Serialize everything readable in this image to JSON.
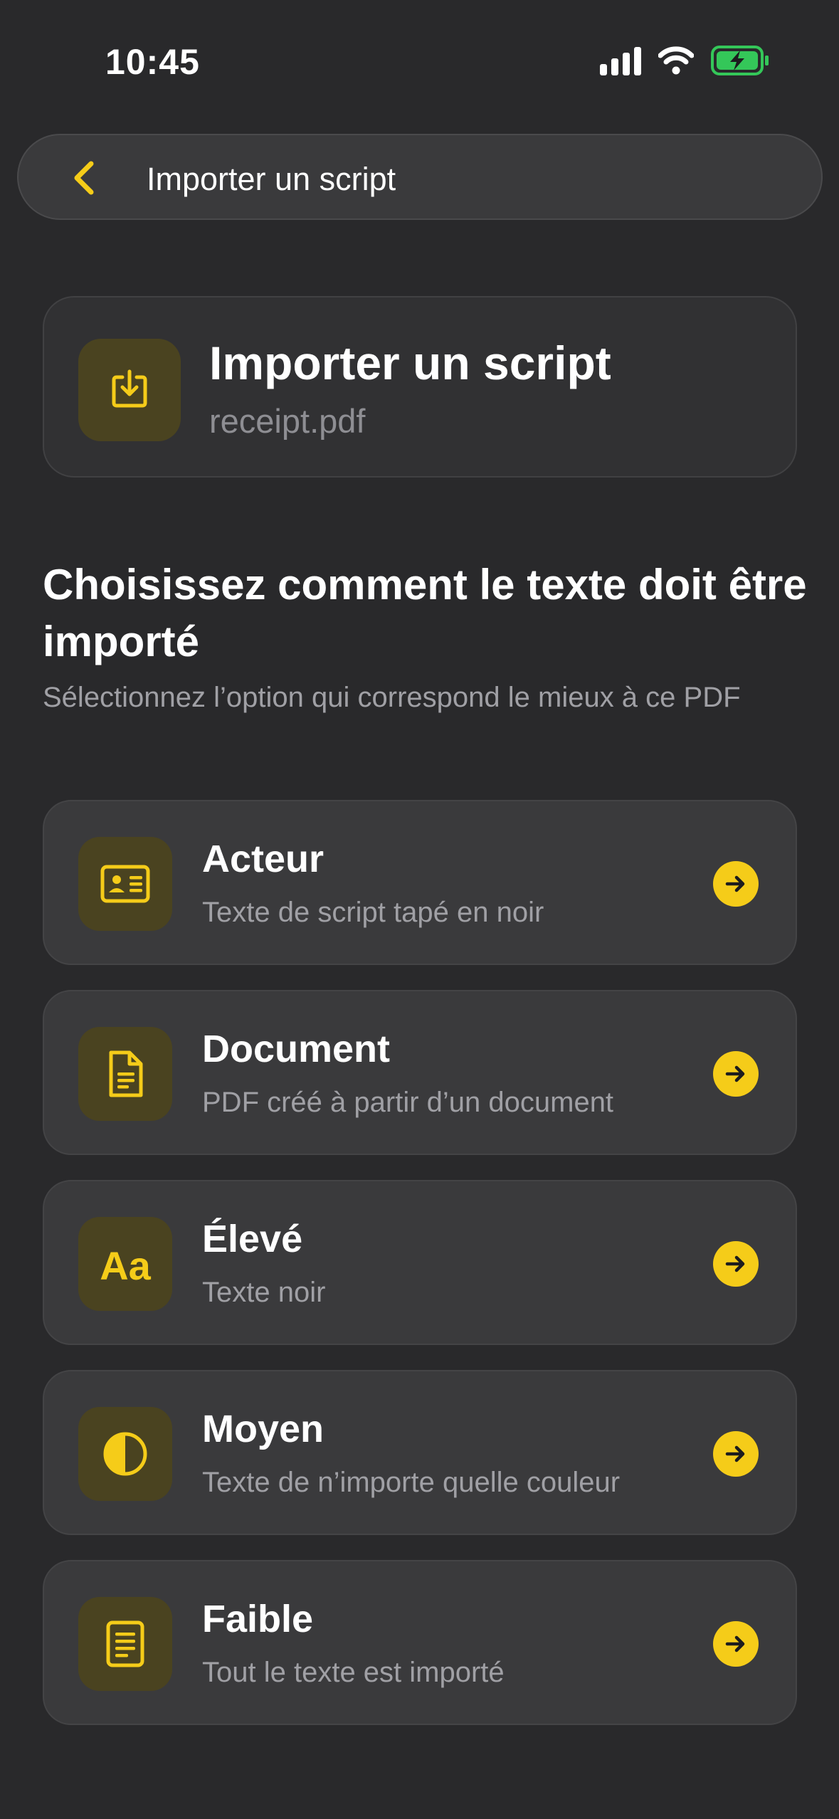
{
  "status_bar": {
    "time": "10:45",
    "icons": [
      "cellular-signal-icon",
      "wifi-icon",
      "battery-charging-icon"
    ]
  },
  "nav": {
    "back_icon": "chevron-left-icon",
    "title": "Importer un script"
  },
  "file_card": {
    "icon": "download-tray-icon",
    "title": "Importer un script",
    "file_name": "receipt.pdf"
  },
  "section": {
    "heading": "Choisissez comment le texte doit être importé",
    "subtitle": "Sélectionnez l’option qui correspond le mieux à ce PDF"
  },
  "options": [
    {
      "icon": "id-card-icon",
      "title": "Acteur",
      "subtitle": "Texte de script tapé en noir"
    },
    {
      "icon": "document-icon",
      "title": "Document",
      "subtitle": "PDF créé à partir d’un document"
    },
    {
      "icon": "text-size-icon",
      "icon_text": "Aa",
      "title": "Élevé",
      "subtitle": "Texte noir"
    },
    {
      "icon": "half-circle-contrast-icon",
      "title": "Moyen",
      "subtitle": "Texte de n’importe quelle couleur"
    },
    {
      "icon": "note-icon",
      "title": "Faible",
      "subtitle": "Tout le texte est importé"
    }
  ],
  "colors": {
    "accent": "#f5cc19",
    "background": "#29292b",
    "card": "#3a3a3c",
    "icon_tile": "#4a4320",
    "secondary_text": "#a0a0a5",
    "battery": "#34c759"
  }
}
